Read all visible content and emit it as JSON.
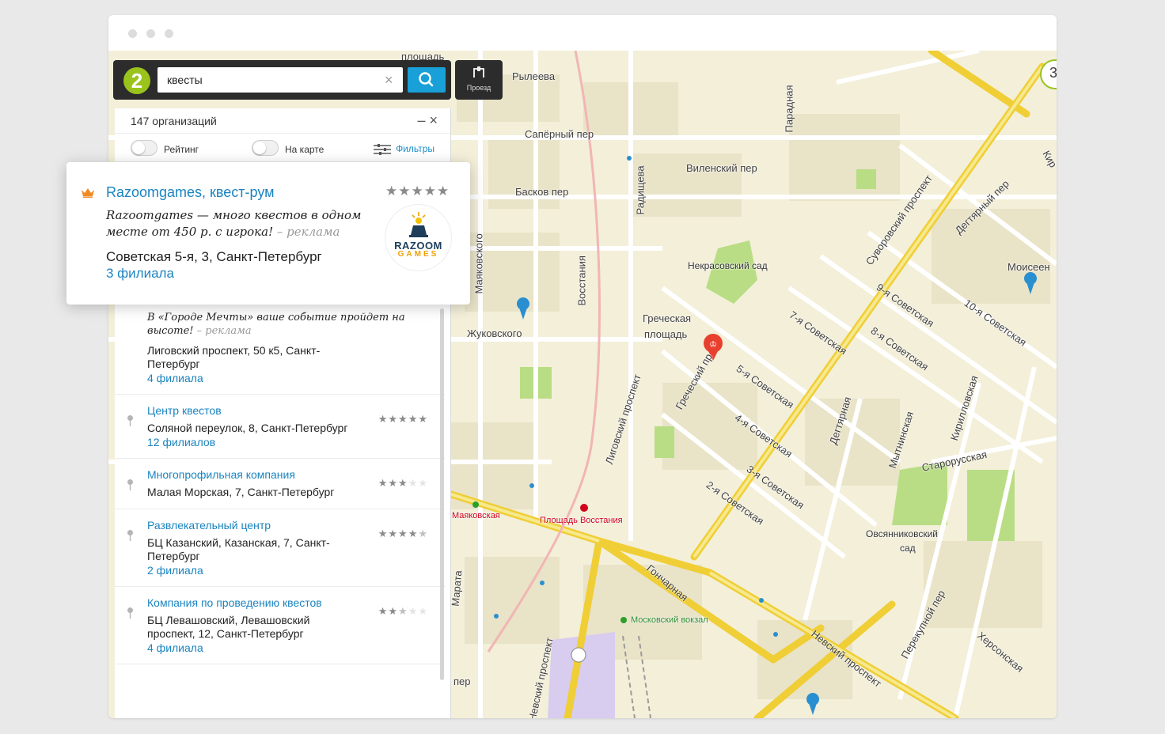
{
  "search": {
    "query": "квесты",
    "clear_glyph": "×",
    "route_label": "Проезд",
    "logo_text": "2"
  },
  "panel": {
    "count": "147 организаций",
    "minimize_glyph": "–",
    "close_glyph": "×",
    "toggle_rating": "Рейтинг",
    "toggle_on_map": "На карте",
    "filters_label": "Фильтры"
  },
  "featured": {
    "title": "Razoomgames, квест-рум",
    "stars": "★★★★★",
    "ad_text": "Razoomgames — много квестов в одном месте от 450 р. с игрока!",
    "ad_note": "– реклама",
    "address": "Советская 5-я, 3, Санкт-Петербург",
    "branches": "3 филиала",
    "logo_line1": "RAZOOM",
    "logo_line2": "GAMES"
  },
  "results": [
    {
      "ad_text": "В «Городе Мечты» ваше событие пройдет на высоте!",
      "ad_note": "– реклама",
      "address": "Лиговский проспект, 50 к5, Санкт-Петербург",
      "branches": "4 филиала"
    },
    {
      "title": "Центр квестов",
      "rating": 5,
      "address": "Соляной переулок, 8, Санкт-Петербург",
      "branches": "12 филиалов"
    },
    {
      "title": "Многопрофильная компания",
      "rating": 3,
      "address": "Малая Морская, 7, Санкт-Петербург",
      "branches": ""
    },
    {
      "title": "Развлекательный центр",
      "rating": 4.5,
      "address": "БЦ Казанский, Казанская, 7, Санкт-Петербург",
      "branches": "2 филиала"
    },
    {
      "title": "Компания по проведению квестов",
      "rating": 2.5,
      "address": "БЦ Левашовский, Левашовский проспект, 12, Санкт-Петербург",
      "branches": "4 филиала"
    }
  ],
  "map": {
    "streets": {
      "s1": "площадь",
      "s2": "Рылеева",
      "s3": "Сапёрный пер",
      "s4": "Виленский пер",
      "s5": "Басков пер",
      "s6": "Радищева",
      "s7": "Парадная",
      "s8": "Суворовский проспект",
      "s9": "Дегтярный пер",
      "s10": "Моисеен",
      "s11": "Некрасовский сад",
      "s12": "Маяковского",
      "s13": "Восстания",
      "s14": "Жуковского",
      "s15": "Греческая",
      "s16": "площадь",
      "s17": "7-я Советская",
      "s18": "8-я Советская",
      "s19": "9-я Советская",
      "s20": "10-я Советская",
      "s21": "Греческий пр",
      "s22": "5-я Советская",
      "s23": "4-я Советская",
      "s24": "3-я Советская",
      "s25": "2-я Советская",
      "s26": "Лиговский проспект",
      "s27": "Дегтярная",
      "s28": "Мытнинская",
      "s29": "Кирилловская",
      "s30": "Старорусская",
      "s31": "Овсянниковский",
      "s32": "сад",
      "s33": "Гончарная",
      "s34": "Невский проспект",
      "s35": "Херсонская",
      "s36": "Перекупной пер",
      "s37": "Марата",
      "s38": "Невский проспект",
      "s39": "пер",
      "s40": "Кир"
    },
    "metro": {
      "m1": "Маяковская",
      "m2": "Площадь Восстания",
      "m3": "Московский вокзал"
    },
    "corner_badge": "3"
  },
  "colors": {
    "accent": "#1a84c0",
    "search_button": "#19a0d8",
    "dark_bar": "#2c2c2c",
    "logo_green": "#9ac31c",
    "marker_red": "#e8402e",
    "marker_blue": "#2a8fd0",
    "road_yellow": "#f3d43a"
  }
}
